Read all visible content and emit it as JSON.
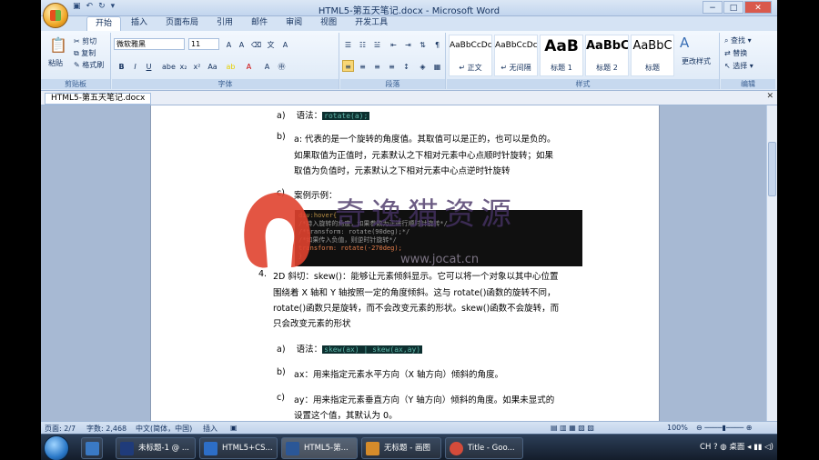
{
  "window": {
    "title": "HTML5-第五天笔记.docx - Microsoft Word",
    "controls": {
      "minimize": "−",
      "maximize": "□",
      "close": "✕"
    }
  },
  "ribbon_tabs": [
    "开始",
    "插入",
    "页面布局",
    "引用",
    "邮件",
    "审阅",
    "视图",
    "开发工具"
  ],
  "clipboard": {
    "label": "剪贴板",
    "paste": "粘贴",
    "cut": "剪切",
    "copy": "复制",
    "format_painter": "格式刷"
  },
  "font": {
    "label": "字体",
    "name": "微软雅黑",
    "size": "11"
  },
  "paragraph": {
    "label": "段落"
  },
  "styles": {
    "label": "样式",
    "items": [
      {
        "sample": "AaBbCcDc",
        "name": "↵ 正文"
      },
      {
        "sample": "AaBbCcDc",
        "name": "↵ 无间隔"
      },
      {
        "sample": "AaB",
        "name": "标题 1"
      },
      {
        "sample": "AaBbC",
        "name": "标题 2"
      },
      {
        "sample": "AaBbC",
        "name": "标题"
      }
    ],
    "change": "更改样式"
  },
  "editing": {
    "label": "编辑",
    "find": "查找 ▾",
    "replace": "替换",
    "select": "选择 ▾"
  },
  "document_tab": "HTML5-第五天笔记.docx",
  "document": {
    "line1_prefix": "a)",
    "line1_label": "语法：",
    "line1_code": "rotate(a);",
    "b_prefix": "b)",
    "b_line1": "a: 代表的是一个旋转的角度值。其取值可以是正的，也可以是负的。",
    "b_line2": "如果取值为正值时，元素默认之下相对元素中心点顺时针旋转；如果",
    "b_line3": "取值为负值时，元素默认之下相对元素中心点逆时针旋转",
    "c_prefix": "c)",
    "c_text": "案例示例：",
    "codeblock": [
      "div:hover{",
      "  /*持入旋转的角度，如果参数为正进行顺时针旋转*/",
      "  /*transform: rotate(90deg);*/",
      "  /*如果传入负值，则逆时针旋转*/",
      "  transform: rotate(-270deg);",
      "}"
    ],
    "p4_num": "4.",
    "p4_line1": "2D 斜切：skew()：能够让元素倾斜显示。它可以将一个对象以其中心位置",
    "p4_line2": "围绕着 X 轴和 Y 轴按照一定的角度倾斜。这与 rotate()函数的旋转不同，",
    "p4_line3": "rotate()函数只是旋转，而不会改变元素的形状。skew()函数不会旋转，而",
    "p4_line4": "只会改变元素的形状",
    "s_a_prefix": "a)",
    "s_a_label": "语法：",
    "s_a_code": "skew(ax)  |  skew(ax,ay)",
    "s_b_prefix": "b)",
    "s_b_text": "ax：用来指定元素水平方向（X 轴方向）倾斜的角度。",
    "s_c_prefix": "c)",
    "s_c_line1": "ay：用来指定元素垂直方向（Y 轴方向）倾斜的角度。如果未显式的",
    "s_c_line2": "设置这个值，其默认为 0。"
  },
  "watermark": {
    "text": "奇逸猫资源",
    "url": "www.jocat.cn"
  },
  "status": {
    "page": "页面: 2/7",
    "words": "字数: 2,468",
    "language": "中文(简体，中国)",
    "mode": "插入",
    "zoom": "100%"
  },
  "taskbar": {
    "items": [
      {
        "label": "未标题-1 @ ...",
        "color": "#1f3b7a"
      },
      {
        "label": "HTML5+CS...",
        "color": "#2d6ec7"
      },
      {
        "label": "HTML5-第...",
        "color": "#2b5797"
      },
      {
        "label": "无标题 - 画图",
        "color": "#d58b2a"
      },
      {
        "label": "Title - Goo...",
        "color": "#d44b3a"
      }
    ],
    "tray": "CH   ?   ◍   桌面   ◂   ▮▮   ◁)"
  }
}
